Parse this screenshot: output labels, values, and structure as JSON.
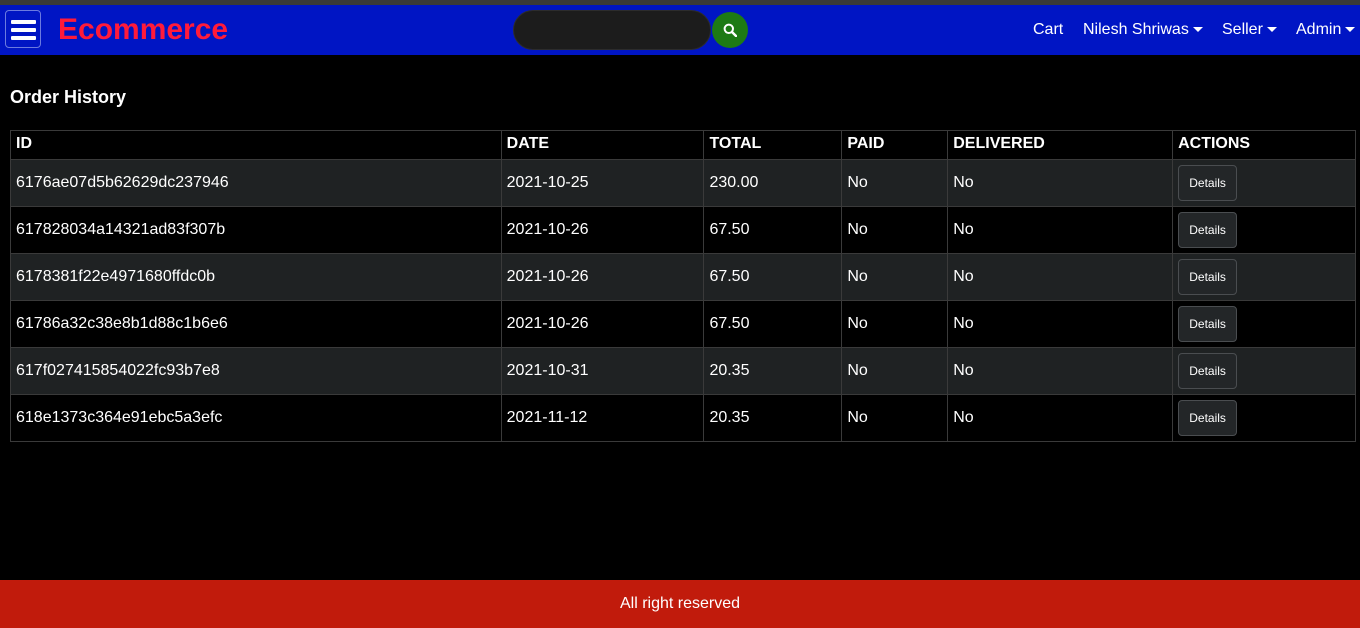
{
  "header": {
    "brand": "Ecommerce",
    "search": {
      "value": "",
      "placeholder": ""
    },
    "nav": {
      "cart": "Cart",
      "user": "Nilesh Shriwas",
      "seller": "Seller",
      "admin": "Admin"
    }
  },
  "page": {
    "title": "Order History"
  },
  "orders": {
    "columns": [
      "ID",
      "DATE",
      "TOTAL",
      "PAID",
      "DELIVERED",
      "ACTIONS"
    ],
    "rows": [
      {
        "id": "6176ae07d5b62629dc237946",
        "date": "2021-10-25",
        "total": "230.00",
        "paid": "No",
        "delivered": "No",
        "action": "Details"
      },
      {
        "id": "617828034a14321ad83f307b",
        "date": "2021-10-26",
        "total": "67.50",
        "paid": "No",
        "delivered": "No",
        "action": "Details"
      },
      {
        "id": "6178381f22e4971680ffdc0b",
        "date": "2021-10-26",
        "total": "67.50",
        "paid": "No",
        "delivered": "No",
        "action": "Details"
      },
      {
        "id": "61786a32c38e8b1d88c1b6e6",
        "date": "2021-10-26",
        "total": "67.50",
        "paid": "No",
        "delivered": "No",
        "action": "Details"
      },
      {
        "id": "617f027415854022fc93b7e8",
        "date": "2021-10-31",
        "total": "20.35",
        "paid": "No",
        "delivered": "No",
        "action": "Details"
      },
      {
        "id": "618e1373c364e91ebc5a3efc",
        "date": "2021-11-12",
        "total": "20.35",
        "paid": "No",
        "delivered": "No",
        "action": "Details"
      }
    ]
  },
  "footer": {
    "text": "All right reserved"
  },
  "icons": {
    "menu": "hamburger-icon",
    "search": "search-icon",
    "dropdown": "caret-down-icon"
  },
  "colors": {
    "header_bg": "#0015c4",
    "brand": "#ff1a3a",
    "search_button": "#1d7a14",
    "footer_bg": "#c11b0c",
    "row_stripe": "#1f2223"
  }
}
